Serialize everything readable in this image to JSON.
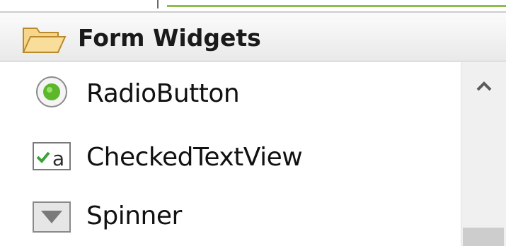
{
  "palette": {
    "category": {
      "title": "Form Widgets",
      "icon": "folder-open-icon"
    },
    "items": [
      {
        "label": "RadioButton",
        "icon": "radio-button-icon"
      },
      {
        "label": "CheckedTextView",
        "icon": "checked-text-view-icon"
      },
      {
        "label": "Spinner",
        "icon": "spinner-icon"
      }
    ]
  },
  "scrollbar": {
    "up_arrow_icon": "chevron-up-icon"
  },
  "colors": {
    "accent_green": "#8bbd4a",
    "radio_green": "#5cb82a",
    "check_green": "#3aa23a",
    "folder_yellow": "#f2c86a"
  }
}
